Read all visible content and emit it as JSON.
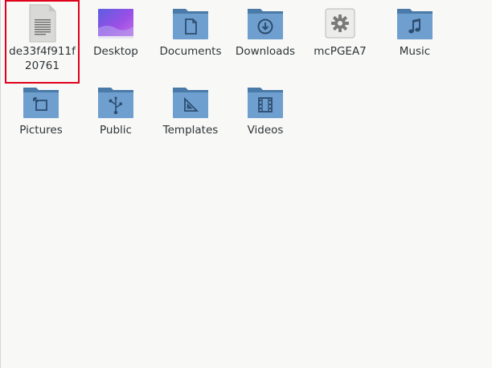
{
  "files": [
    {
      "label": "de33f4f911f20761",
      "icon": "text-file-icon",
      "kind": "file",
      "selected": true
    },
    {
      "label": "Desktop",
      "icon": "desktop-folder-icon",
      "kind": "folder"
    },
    {
      "label": "Documents",
      "icon": "document-icon",
      "kind": "folder"
    },
    {
      "label": "Downloads",
      "icon": "download-icon",
      "kind": "folder"
    },
    {
      "label": "mcPGEA7",
      "icon": "gear-icon",
      "kind": "executable"
    },
    {
      "label": "Music",
      "icon": "music-note-icon",
      "kind": "folder"
    },
    {
      "label": "Pictures",
      "icon": "picture-icon",
      "kind": "folder"
    },
    {
      "label": "Public",
      "icon": "share-icon",
      "kind": "folder"
    },
    {
      "label": "Templates",
      "icon": "template-icon",
      "kind": "folder"
    },
    {
      "label": "Videos",
      "icon": "film-icon",
      "kind": "folder"
    }
  ],
  "colors": {
    "folder_back": "#4a7aa8",
    "folder_front": "#6f9fcf",
    "folder_emblem": "#2c4d70",
    "selection_border": "#e0001b"
  }
}
